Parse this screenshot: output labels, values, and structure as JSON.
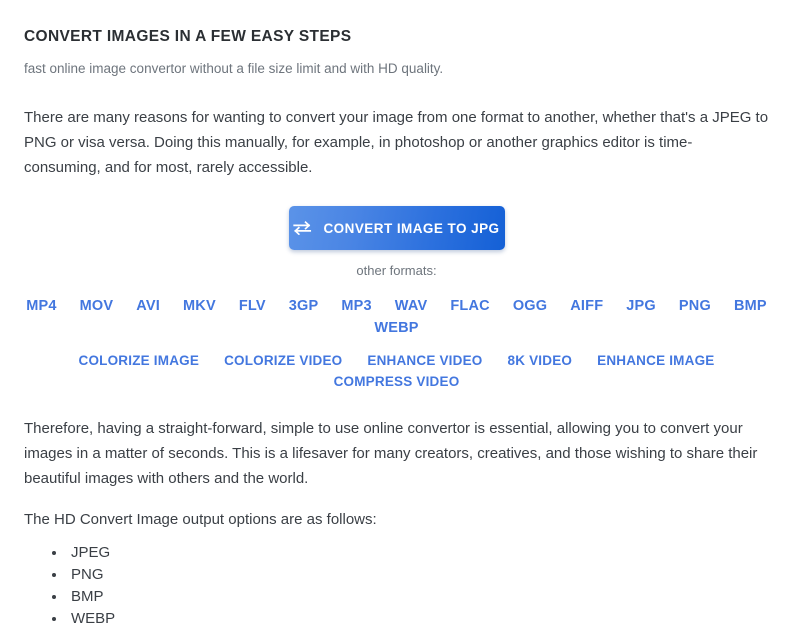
{
  "header": {
    "headline": "CONVERT IMAGES IN A FEW EASY STEPS",
    "subhead": "fast online image convertor without a file size limit and with HD quality."
  },
  "body": {
    "intro_paragraph": "There are many reasons for wanting to convert your image from one format to another, whether that's a JPEG to PNG or visa versa. Doing this manually, for example, in photoshop or another graphics editor is time-consuming, and for most, rarely accessible.",
    "therefore_paragraph": "Therefore, having a straight-forward, simple to use online convertor is essential, allowing you to convert your images in a matter of seconds. This is a lifesaver for many creators, creatives, and those wishing to share their beautiful images with others and the world.",
    "options_intro": "The HD Convert Image output options are as follows:"
  },
  "cta": {
    "label": "CONVERT IMAGE TO JPG",
    "icon": "swap-arrows-icon",
    "gradient_start": "#5b93e8",
    "gradient_end": "#1460d6",
    "text_color": "#ffffff"
  },
  "formats_section": {
    "label": "other formats:",
    "link_color": "#4377df",
    "formats": [
      "MP4",
      "MOV",
      "AVI",
      "MKV",
      "FLV",
      "3GP",
      "MP3",
      "WAV",
      "FLAC",
      "OGG",
      "AIFF",
      "JPG",
      "PNG",
      "BMP",
      "WEBP"
    ],
    "tools": [
      "COLORIZE IMAGE",
      "COLORIZE VIDEO",
      "ENHANCE VIDEO",
      "8K VIDEO",
      "ENHANCE IMAGE",
      "COMPRESS VIDEO"
    ]
  },
  "output_options": [
    "JPEG",
    "PNG",
    "BMP",
    "WEBP"
  ]
}
